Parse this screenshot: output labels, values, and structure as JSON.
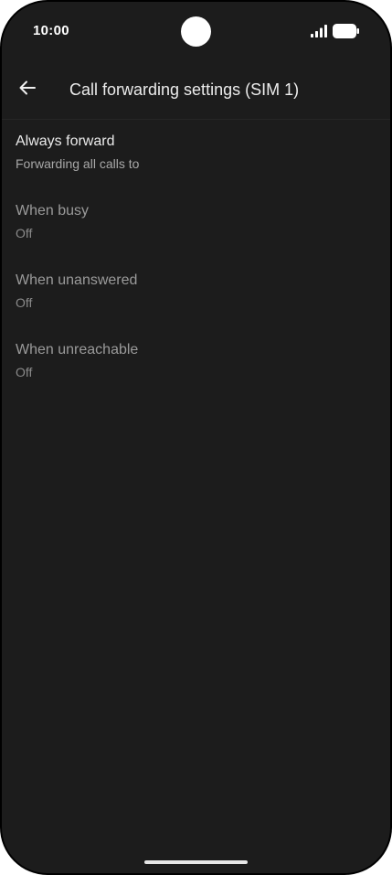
{
  "status_bar": {
    "time": "10:00",
    "icons": [
      "signal-icon",
      "battery-icon"
    ]
  },
  "app_bar": {
    "back_icon": "arrow-left-icon",
    "title": "Call forwarding settings (SIM 1)"
  },
  "settings": [
    {
      "title": "Always forward",
      "summary": "Forwarding all calls to",
      "enabled": true
    },
    {
      "title": "When busy",
      "summary": "Off",
      "enabled": false
    },
    {
      "title": "When unanswered",
      "summary": "Off",
      "enabled": false
    },
    {
      "title": "When unreachable",
      "summary": "Off",
      "enabled": false
    }
  ],
  "colors": {
    "background": "#1c1c1c",
    "text_primary": "#eaeaea",
    "text_secondary": "#a8a8a8",
    "text_disabled": "#9a9a9a"
  }
}
